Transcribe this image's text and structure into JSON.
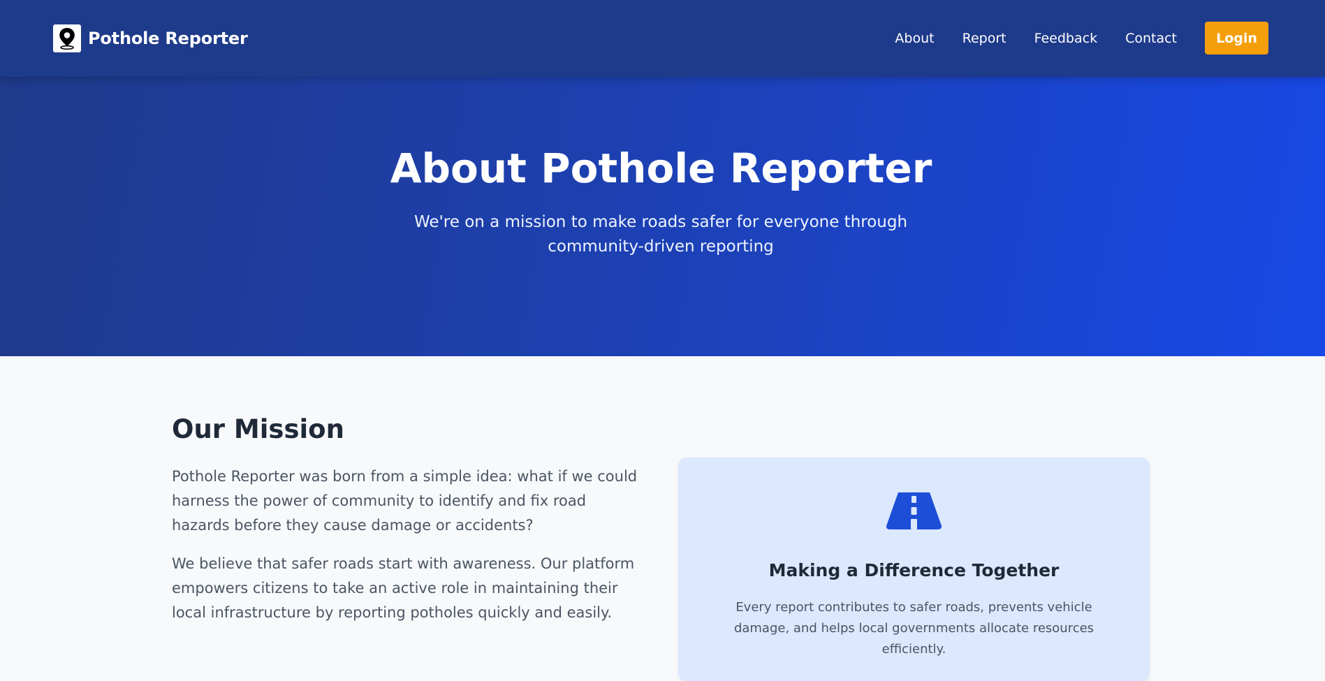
{
  "navbar": {
    "brand": "Pothole Reporter",
    "brand_icon": "map-pin-icon",
    "links": [
      "About",
      "Report",
      "Feedback",
      "Contact"
    ],
    "login_label": "Login",
    "colors": {
      "background": "#1e3a8a",
      "login": "#f59e0b"
    }
  },
  "hero": {
    "title": "About Pothole Reporter",
    "subtitle": "We're on a mission to make roads safer for everyone through community-driven reporting",
    "colors": {
      "gradient_start": "#1f3a8a",
      "gradient_end": "#1848e6"
    }
  },
  "mission": {
    "title": "Our Mission",
    "paragraphs": [
      "Pothole Reporter was born from a simple idea: what if we could harness the power of community to identify and fix road hazards before they cause damage or accidents?",
      "We believe that safer roads start with awareness. Our platform empowers citizens to take an active role in maintaining their local infrastructure by reporting potholes quickly and easily."
    ],
    "card": {
      "icon": "road-icon",
      "title": "Making a Difference Together",
      "text": "Every report contributes to safer roads, prevents vehicle damage, and helps local governments allocate resources efficiently.",
      "colors": {
        "background": "#dbe8fd",
        "icon": "#1d4ed8"
      }
    }
  }
}
